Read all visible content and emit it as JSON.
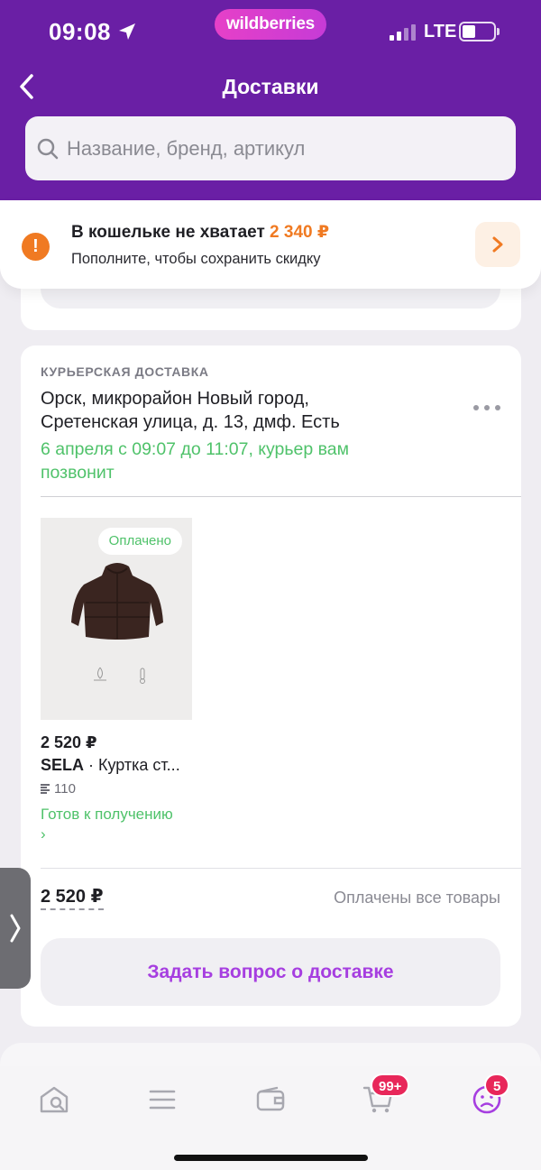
{
  "status_bar": {
    "time": "09:08",
    "brand": "wildberries",
    "network": "LTE"
  },
  "header": {
    "title": "Доставки"
  },
  "search": {
    "placeholder": "Название, бренд, артикул"
  },
  "wallet_notice": {
    "title": "В кошельке не хватает",
    "amount": "2 340 ₽",
    "subtitle": "Пополните, чтобы сохранить скидку"
  },
  "delivery": {
    "type_label": "КУРЬЕРСКАЯ ДОСТАВКА",
    "address": "Орск, микрорайон Новый город, Сретенская улица, д. 13, дмф. Есть",
    "time": "6 апреля с 09:07 до 11:07, курьер вам позвонит",
    "item": {
      "badge": "Оплачено",
      "price": "2 520 ₽",
      "brand": "SELA",
      "name": " · Куртка ст...",
      "size": "110",
      "status": "Готов к получению ›"
    },
    "total": "2 520 ₽",
    "payment_status": "Оплачены все товары",
    "ask_button": "Задать вопрос о доставке"
  },
  "tabbar": {
    "cart_badge": "99+",
    "profile_badge": "5",
    "accent": "#a63ee0",
    "tabs": [
      "home-icon",
      "catalog-icon",
      "wallet-icon",
      "cart-icon",
      "profile-icon"
    ]
  },
  "colors": {
    "header": "#6a1fa5",
    "green": "#4fc26a",
    "orange": "#f07a22",
    "purple": "#a63ee0"
  }
}
